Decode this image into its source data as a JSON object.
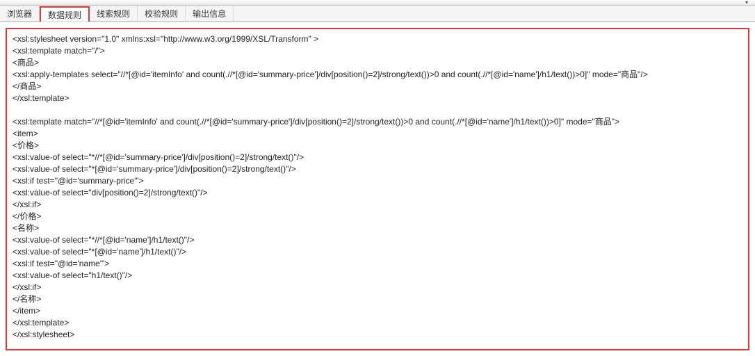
{
  "toolbar": {
    "dropdown_icon": "▾"
  },
  "tabs": {
    "browser": "浏览器",
    "data_rule": "数据规则",
    "clue_rule": "线索规则",
    "check_rule": "校验规则",
    "output_info": "输出信息"
  },
  "xsl": {
    "line1": "<xsl:stylesheet version=\"1.0\" xmlns:xsl=\"http://www.w3.org/1999/XSL/Transform\" >",
    "line2": "<xsl:template match=\"/\">",
    "line3": "<商品>",
    "line4": "<xsl:apply-templates select=\"//*[@id='itemInfo' and count(.//*[@id='summary-price']/div[position()=2]/strong/text())>0 and count(.//*[@id='name']/h1/text())>0]\" mode=\"商品\"/>",
    "line5": "</商品>",
    "line6": "</xsl:template>",
    "blank1": "",
    "line7": "<xsl:template match=\"//*[@id='itemInfo' and count(.//*[@id='summary-price']/div[position()=2]/strong/text())>0 and count(.//*[@id='name']/h1/text())>0]\" mode=\"商品\">",
    "line8": "<item>",
    "line9": "<价格>",
    "line10": "<xsl:value-of select=\"*//*[@id='summary-price']/div[position()=2]/strong/text()\"/>",
    "line11": "<xsl:value-of select=\"*[@id='summary-price']/div[position()=2]/strong/text()\"/>",
    "line12": "<xsl:if test=\"@id='summary-price'\">",
    "line13": "<xsl:value-of select=\"div[position()=2]/strong/text()\"/>",
    "line14": "</xsl:if>",
    "line15": "</价格>",
    "line16": "<名称>",
    "line17": "<xsl:value-of select=\"*//*[@id='name']/h1/text()\"/>",
    "line18": "<xsl:value-of select=\"*[@id='name']/h1/text()\"/>",
    "line19": "<xsl:if test=\"@id='name'\">",
    "line20": "<xsl:value-of select=\"h1/text()\"/>",
    "line21": "</xsl:if>",
    "line22": "</名称>",
    "line23": "</item>",
    "line24": "</xsl:template>",
    "line25": "</xsl:stylesheet>"
  }
}
